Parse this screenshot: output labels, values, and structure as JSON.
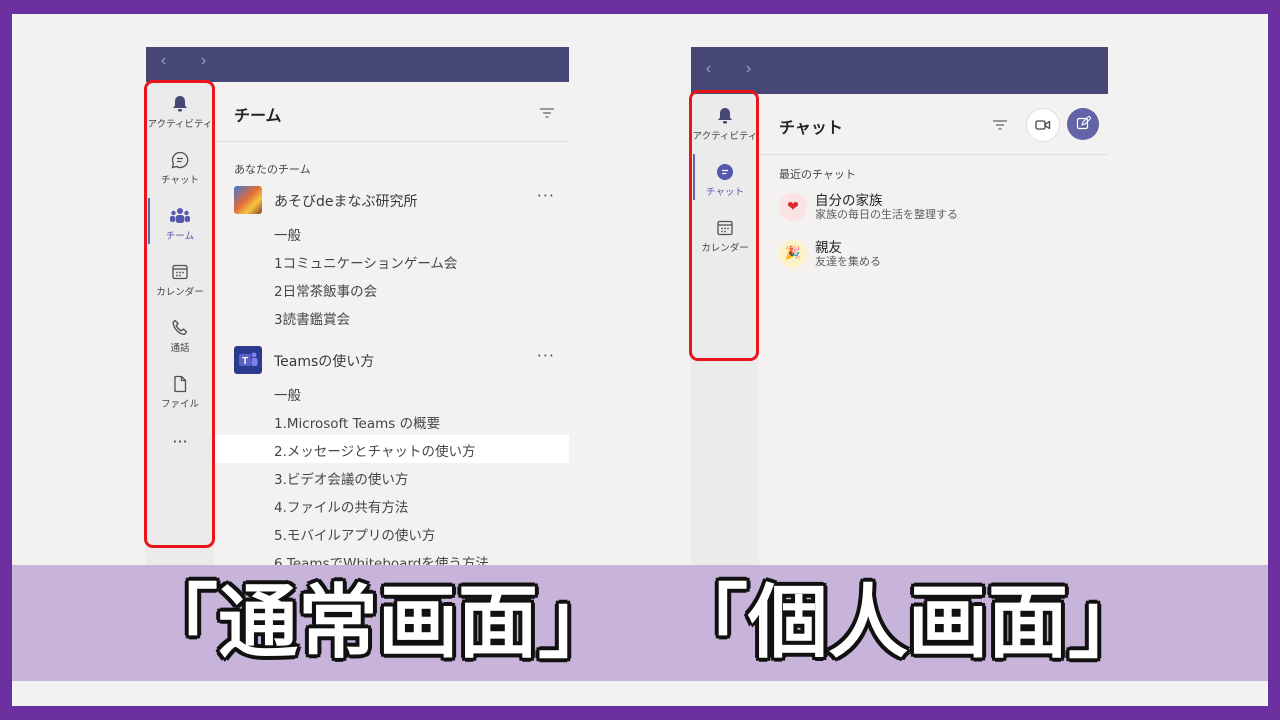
{
  "left_window": {
    "nav_arrows": "‹ ›",
    "rail": [
      {
        "label": "アクティビティ",
        "icon": "bell-icon"
      },
      {
        "label": "チャット",
        "icon": "chat-icon"
      },
      {
        "label": "チーム",
        "icon": "teams-icon",
        "active": true
      },
      {
        "label": "カレンダー",
        "icon": "calendar-icon"
      },
      {
        "label": "通話",
        "icon": "phone-icon"
      },
      {
        "label": "ファイル",
        "icon": "file-icon"
      }
    ],
    "rail_more": "···",
    "pane_title": "チーム",
    "section_label": "あなたのチーム",
    "teams": [
      {
        "name": "あそびdeまなぶ研究所",
        "more": "···",
        "channels": [
          "一般",
          "1コミュニケーションゲーム会",
          "2日常茶飯事の会",
          "3読書鑑賞会"
        ]
      },
      {
        "name": "Teamsの使い方",
        "more": "···",
        "channels": [
          "一般",
          "1.Microsoft Teams の概要",
          "2.メッセージとチャットの使い方",
          "3.ビデオ会議の使い方",
          "4.ファイルの共有方法",
          "5.モバイルアプリの使い方",
          "6.TeamsでWhiteboardを使う方法"
        ]
      }
    ],
    "selected_channel": "2.メッセージとチャットの使い方"
  },
  "right_window": {
    "nav_arrows": "‹ ›",
    "rail": [
      {
        "label": "アクティビティ",
        "icon": "bell-icon"
      },
      {
        "label": "チャット",
        "icon": "chat-icon",
        "active": true
      },
      {
        "label": "カレンダー",
        "icon": "calendar-icon"
      }
    ],
    "pane_title": "チャット",
    "section_label": "最近のチャット",
    "chats": [
      {
        "title": "自分の家族",
        "subtitle": "家族の毎日の生活を整理する",
        "icon": "heart-icon",
        "avatar_bg": "#fbe2e3",
        "glyph": "❤"
      },
      {
        "title": "親友",
        "subtitle": "友達を集める",
        "icon": "party-icon",
        "avatar_bg": "#fdf1c7",
        "glyph": "🎉"
      }
    ]
  },
  "caption": {
    "left": "「通常画面」",
    "right": "「個人画面」"
  },
  "colors": {
    "frame": "#6b2fa0",
    "titlebar": "#464775",
    "accent": "#6264a7",
    "highlight_box": "#e8151b",
    "banner": "#c8b3da"
  }
}
